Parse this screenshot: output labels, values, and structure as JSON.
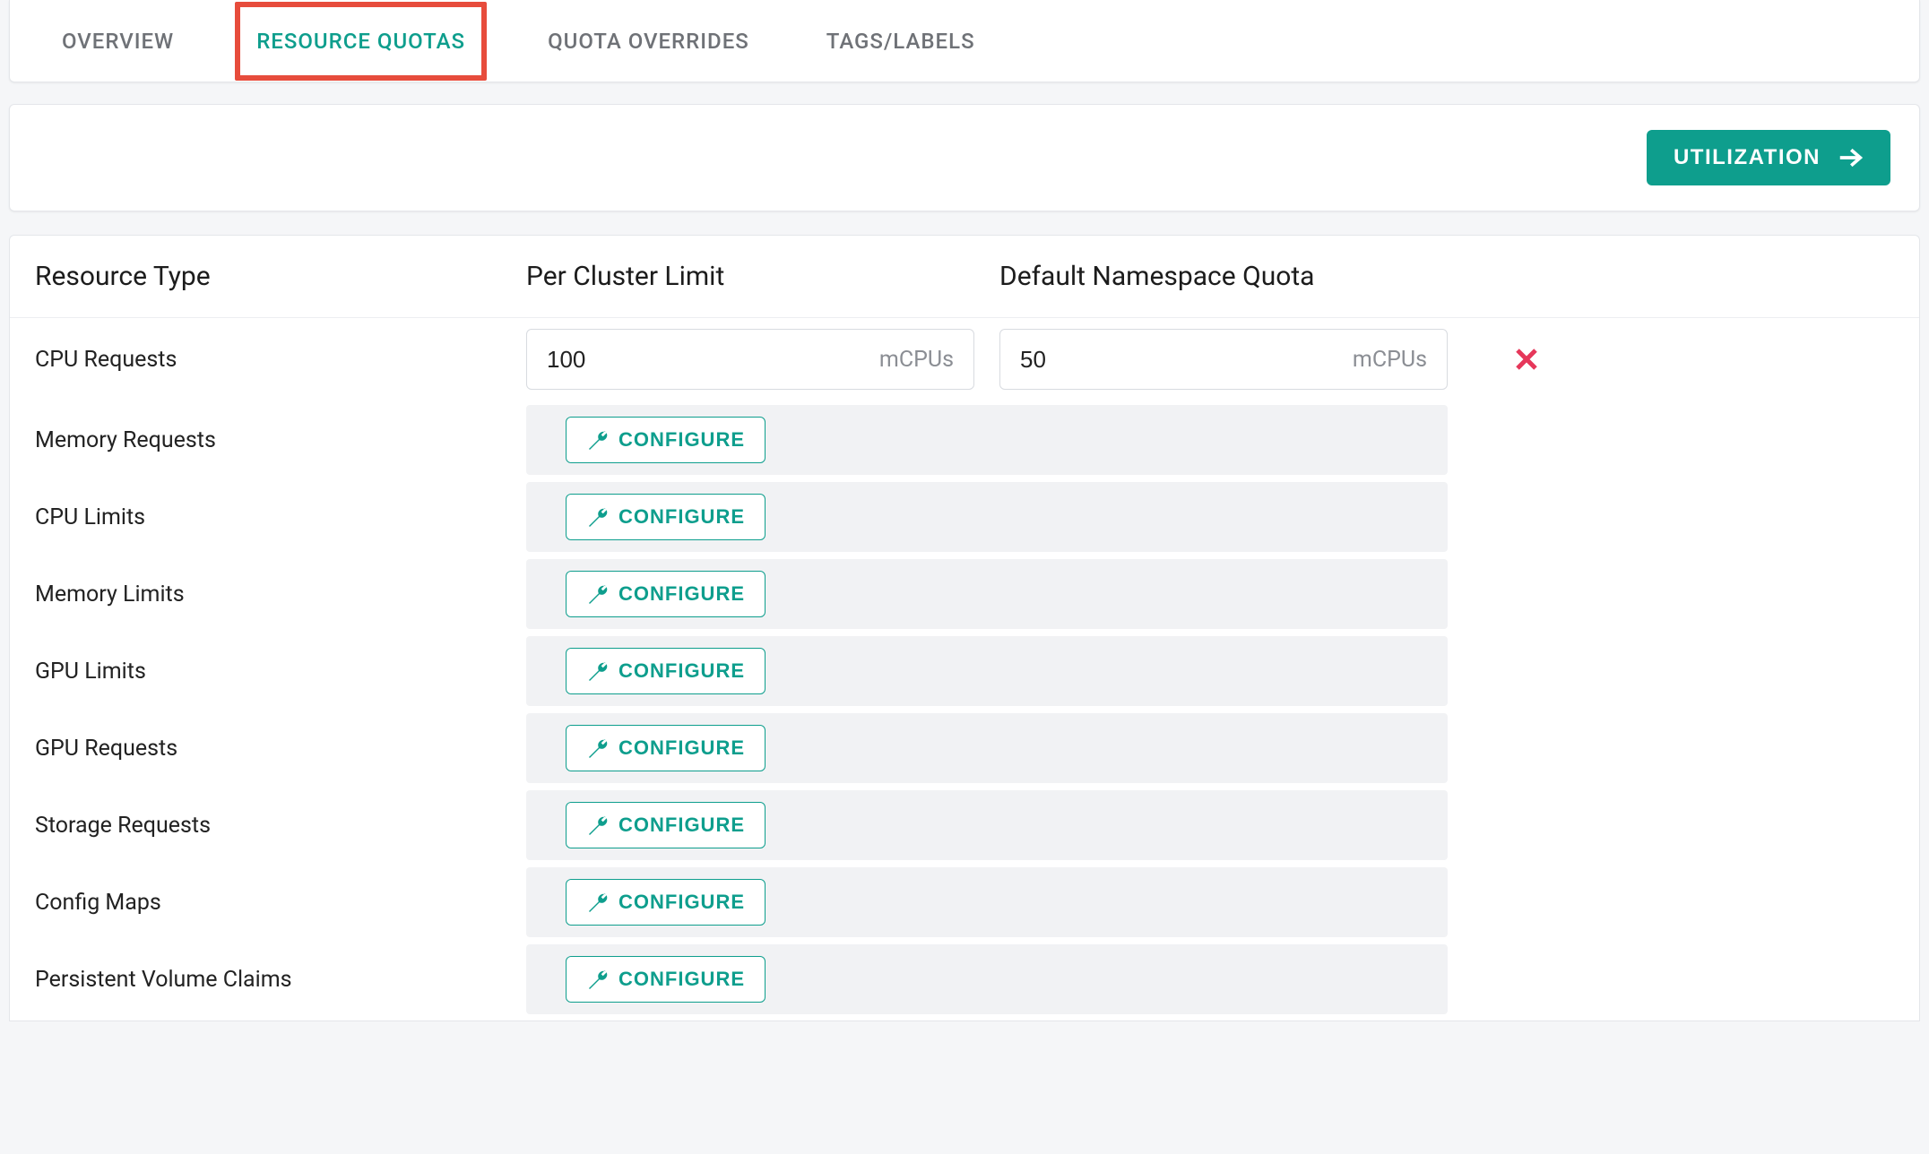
{
  "tabs": {
    "overview": {
      "label": "OVERVIEW"
    },
    "resource_quotas": {
      "label": "RESOURCE QUOTAS"
    },
    "quota_overrides": {
      "label": "QUOTA OVERRIDES"
    },
    "tags_labels": {
      "label": "TAGS/LABELS"
    }
  },
  "utilization_label": "UTILIZATION",
  "columns": {
    "resource_type": "Resource Type",
    "per_cluster": "Per Cluster Limit",
    "namespace": "Default Namespace Quota"
  },
  "configure_label": "CONFIGURE",
  "rows": {
    "cpu_requests": {
      "label": "CPU Requests",
      "cluster_value": "100",
      "cluster_unit": "mCPUs",
      "namespace_value": "50",
      "namespace_unit": "mCPUs"
    },
    "memory_requests": {
      "label": "Memory Requests"
    },
    "cpu_limits": {
      "label": "CPU Limits"
    },
    "memory_limits": {
      "label": "Memory Limits"
    },
    "gpu_limits": {
      "label": "GPU Limits"
    },
    "gpu_requests": {
      "label": "GPU Requests"
    },
    "storage_requests": {
      "label": "Storage Requests"
    },
    "config_maps": {
      "label": "Config Maps"
    },
    "pvc": {
      "label": "Persistent Volume Claims"
    }
  }
}
